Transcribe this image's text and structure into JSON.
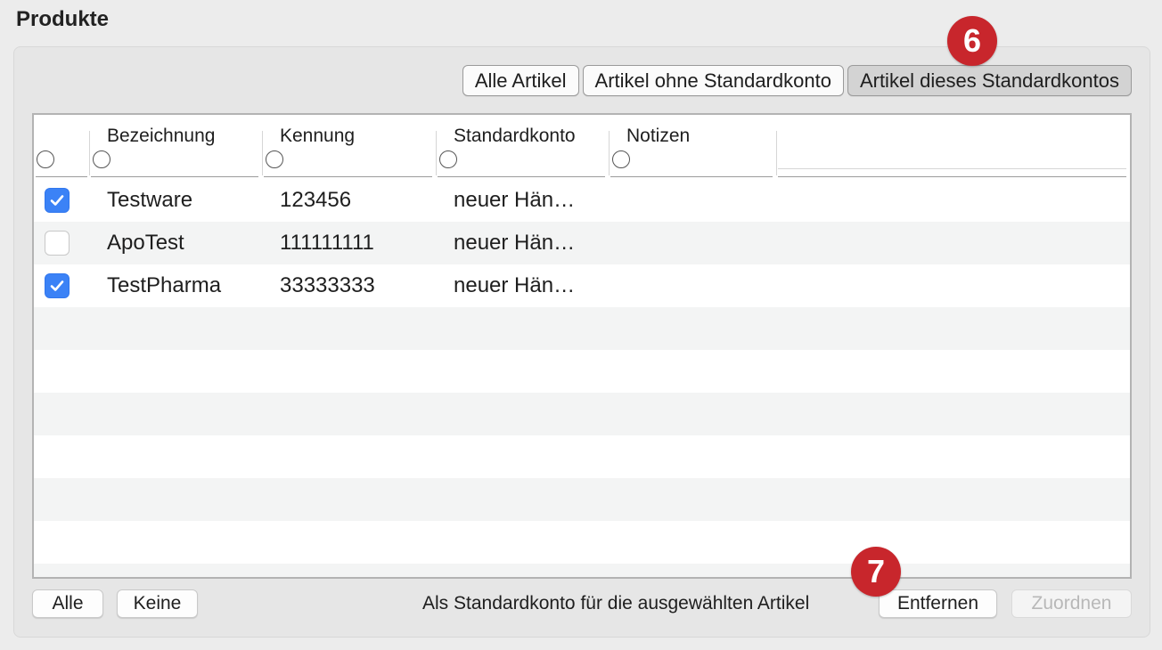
{
  "section": {
    "title": "Produkte"
  },
  "filters": [
    {
      "label": "Alle Artikel",
      "active": false
    },
    {
      "label": "Artikel ohne Standardkonto",
      "active": false
    },
    {
      "label": "Artikel dieses Standardkontos",
      "active": true
    }
  ],
  "table": {
    "columns": [
      "Bezeichnung",
      "Kennung",
      "Standardkonto",
      "Notizen"
    ],
    "rows": [
      {
        "checked": true,
        "bezeichnung": "Testware",
        "kennung": "123456",
        "standardkonto": "neuer Hän…",
        "notizen": ""
      },
      {
        "checked": false,
        "bezeichnung": "ApoTest",
        "kennung": "111111111",
        "standardkonto": "neuer Hän…",
        "notizen": ""
      },
      {
        "checked": true,
        "bezeichnung": "TestPharma",
        "kennung": "33333333",
        "standardkonto": "neuer Hän…",
        "notizen": ""
      }
    ]
  },
  "footer": {
    "all_label": "Alle",
    "none_label": "Keine",
    "assign_text": "Als Standardkonto für die ausgewählten Artikel",
    "remove_label": "Entfernen",
    "assign_label": "Zuordnen"
  },
  "badges": {
    "filter": "6",
    "footer": "7"
  },
  "colors": {
    "accent": "#3b82f6",
    "badge": "#c8262c"
  }
}
